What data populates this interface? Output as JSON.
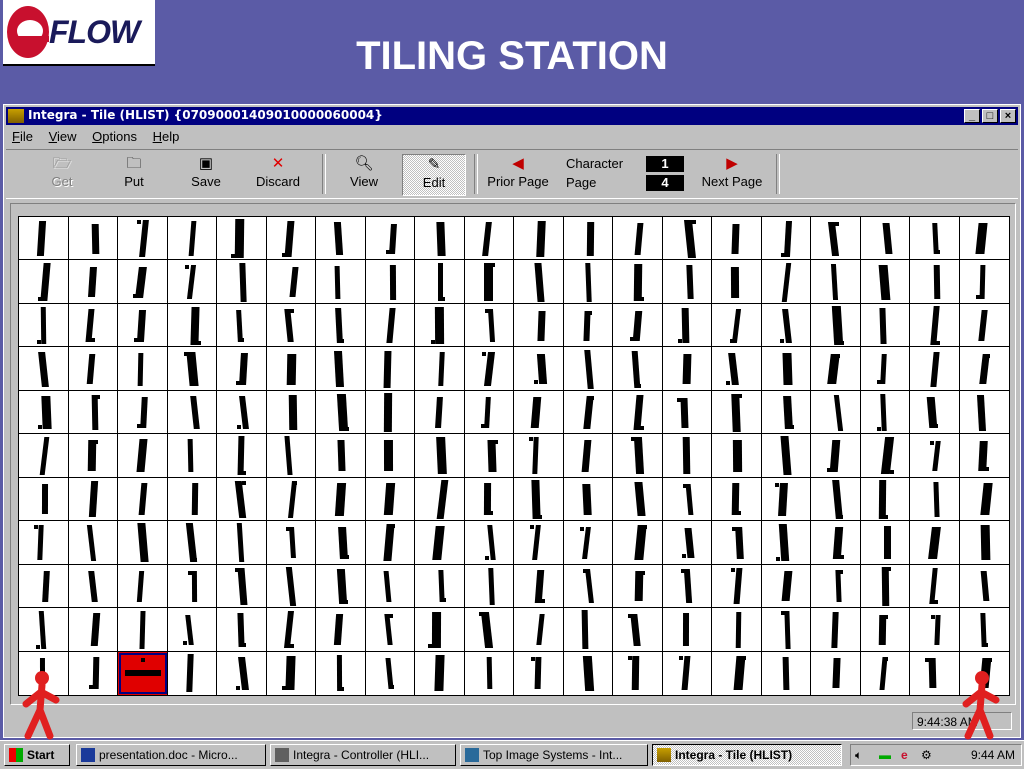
{
  "slide": {
    "logo_text": "FLOW",
    "title": "TILING STATION"
  },
  "window": {
    "title": "Integra - Tile (HLIST) {07090001409010000060004}",
    "menu": [
      "File",
      "View",
      "Options",
      "Help"
    ],
    "toolbar": {
      "get": {
        "label": "Get",
        "icon": "get-folder-icon",
        "disabled": true
      },
      "put": {
        "label": "Put",
        "icon": "put-folder-icon"
      },
      "save": {
        "label": "Save",
        "icon": "floppy-icon"
      },
      "discard": {
        "label": "Discard",
        "icon": "red-x-icon"
      },
      "view": {
        "label": "View",
        "icon": "magnifier-icon"
      },
      "edit": {
        "label": "Edit",
        "icon": "pencil-icon",
        "pressed": true
      },
      "prior_page": {
        "label": "Prior Page",
        "icon": "prior-page-icon"
      },
      "next_page": {
        "label": "Next Page",
        "icon": "next-page-icon"
      }
    },
    "counter": {
      "character_label": "Character",
      "character_value": "1",
      "page_label": "Page",
      "page_value": "4"
    },
    "grid": {
      "rows": 11,
      "cols": 20,
      "highlight_row": 10,
      "highlight_col": 2,
      "highlight_color": "#e00000"
    },
    "status_time": "9:44:38 AM"
  },
  "taskbar": {
    "start_label": "Start",
    "tasks": [
      {
        "label": "presentation.doc - Micro...",
        "icon": "word-icon"
      },
      {
        "label": "Integra - Controller (HLI...",
        "icon": "controller-icon"
      },
      {
        "label": "Top Image Systems - Int...",
        "icon": "network-icon"
      },
      {
        "label": "Integra - Tile (HLIST)",
        "icon": "tile-app-icon",
        "active": true
      }
    ],
    "clock": "9:44 AM"
  },
  "colors": {
    "slide_bg": "#5b5ba6",
    "titlebar": "#000080",
    "win_bg": "#c0c0c0",
    "accent_red": "#c8102e"
  }
}
